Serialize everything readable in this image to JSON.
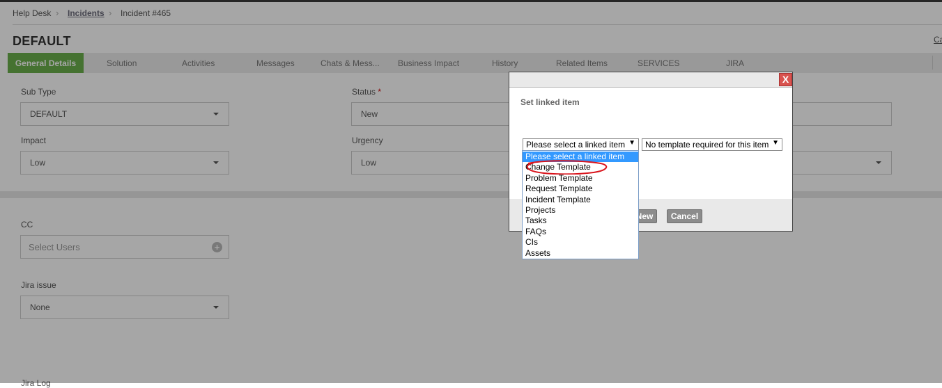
{
  "breadcrumb": {
    "home": "Help Desk",
    "section": "Incidents",
    "current": "Incident #465"
  },
  "page": {
    "title": "DEFAULT",
    "right_link": "Ca"
  },
  "tabs": [
    "General Details",
    "Solution",
    "Activities",
    "Messages",
    "Chats & Mess...",
    "Business Impact",
    "History",
    "Related Items",
    "SERVICES",
    "JIRA"
  ],
  "form": {
    "sub_type_label": "Sub Type",
    "sub_type_value": "DEFAULT",
    "status_label": "Status",
    "status_required": "*",
    "status_value": "New",
    "impact_label": "Impact",
    "impact_value": "Low",
    "urgency_label": "Urgency",
    "urgency_value": "Low",
    "cc_label": "CC",
    "cc_placeholder": "Select Users",
    "jira_issue_label": "Jira issue",
    "jira_issue_value": "None",
    "jira_log_label": "Jira Log"
  },
  "dialog": {
    "close": "X",
    "title": "Set linked item",
    "linked_select_value": "Please select a linked item",
    "template_select_value": "No template required for this item",
    "new_button": "New",
    "cancel_button": "Cancel",
    "options": [
      "Please select a linked item",
      "Change Template",
      "Problem Template",
      "Request Template",
      "Incident Template",
      "Projects",
      "Tasks",
      "FAQs",
      "CIs",
      "Assets"
    ],
    "selected_index": 0,
    "annotated_index": 1,
    "annotation_color": "#d9141c"
  },
  "colors": {
    "active_tab": "#6ab04c",
    "selected_option": "#3399ff",
    "close_button": "#d9534f"
  }
}
